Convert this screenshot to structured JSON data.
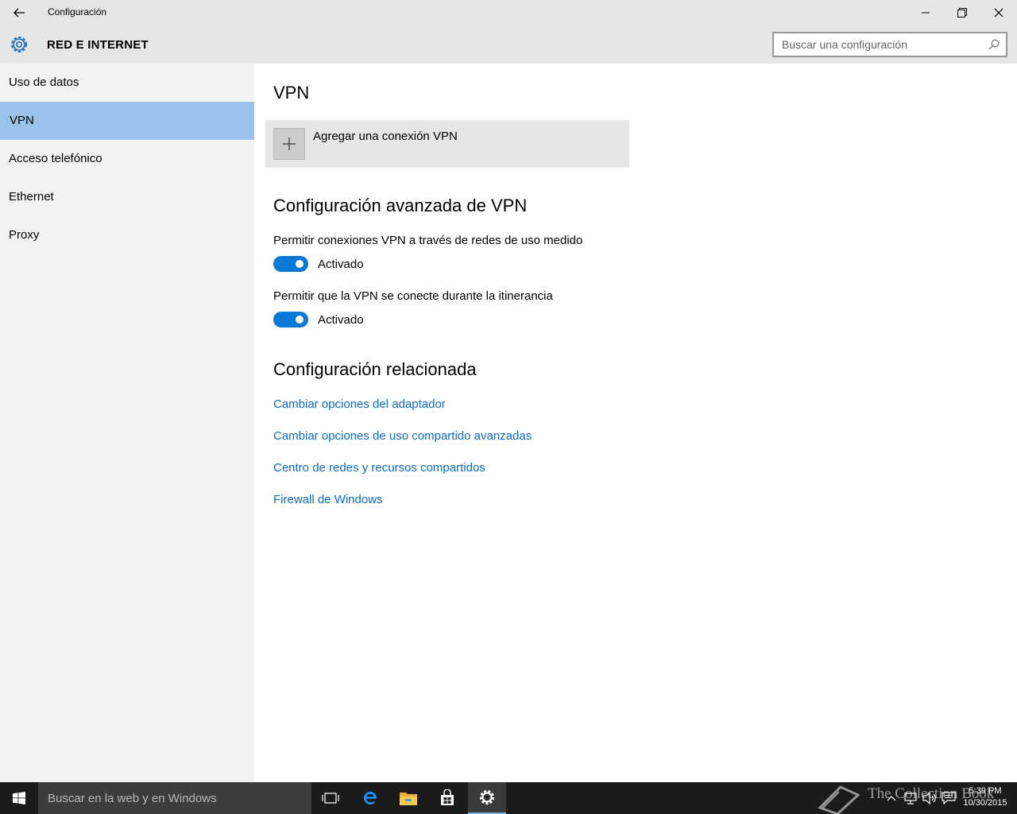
{
  "window": {
    "app_title": "Configuración",
    "controls": {
      "minimize": "minimize-icon",
      "maximize": "maximize-icon",
      "close": "close-icon"
    }
  },
  "header": {
    "section_title": "RED E INTERNET",
    "icon": "gear-icon",
    "search_placeholder": "Buscar una configuración"
  },
  "sidebar": {
    "items": [
      {
        "label": "Uso de datos",
        "active": false
      },
      {
        "label": "VPN",
        "active": true
      },
      {
        "label": "Acceso telefónico",
        "active": false
      },
      {
        "label": "Ethernet",
        "active": false
      },
      {
        "label": "Proxy",
        "active": false
      }
    ],
    "active_color": "#99c3ea"
  },
  "main": {
    "vpn_heading": "VPN",
    "add_vpn_label": "Agregar una conexión VPN",
    "advanced_heading": "Configuración avanzada de VPN",
    "options": [
      {
        "label": "Permitir conexiones VPN a través de redes de uso medido",
        "state": "Activado",
        "on": true
      },
      {
        "label": "Permitir que la VPN se conecte durante la itinerancia",
        "state": "Activado",
        "on": true
      }
    ],
    "related_heading": "Configuración relacionada",
    "links": [
      "Cambiar opciones del adaptador",
      "Cambiar opciones de uso compartido avanzadas",
      "Centro de redes y recursos compartidos",
      "Firewall de Windows"
    ],
    "accent_color": "#0a78d7",
    "link_color": "#0a6cc4"
  },
  "taskbar": {
    "search_text": "Buscar en la web y en Windows",
    "apps": [
      "task-view-icon",
      "edge-icon",
      "file-explorer-icon",
      "store-icon",
      "settings-icon"
    ],
    "tray": [
      "chevron-up-icon",
      "network-icon",
      "volume-icon",
      "action-center-icon"
    ],
    "time": "5:39 PM",
    "date": "10/30/2015",
    "watermark": "The Collection Book"
  }
}
